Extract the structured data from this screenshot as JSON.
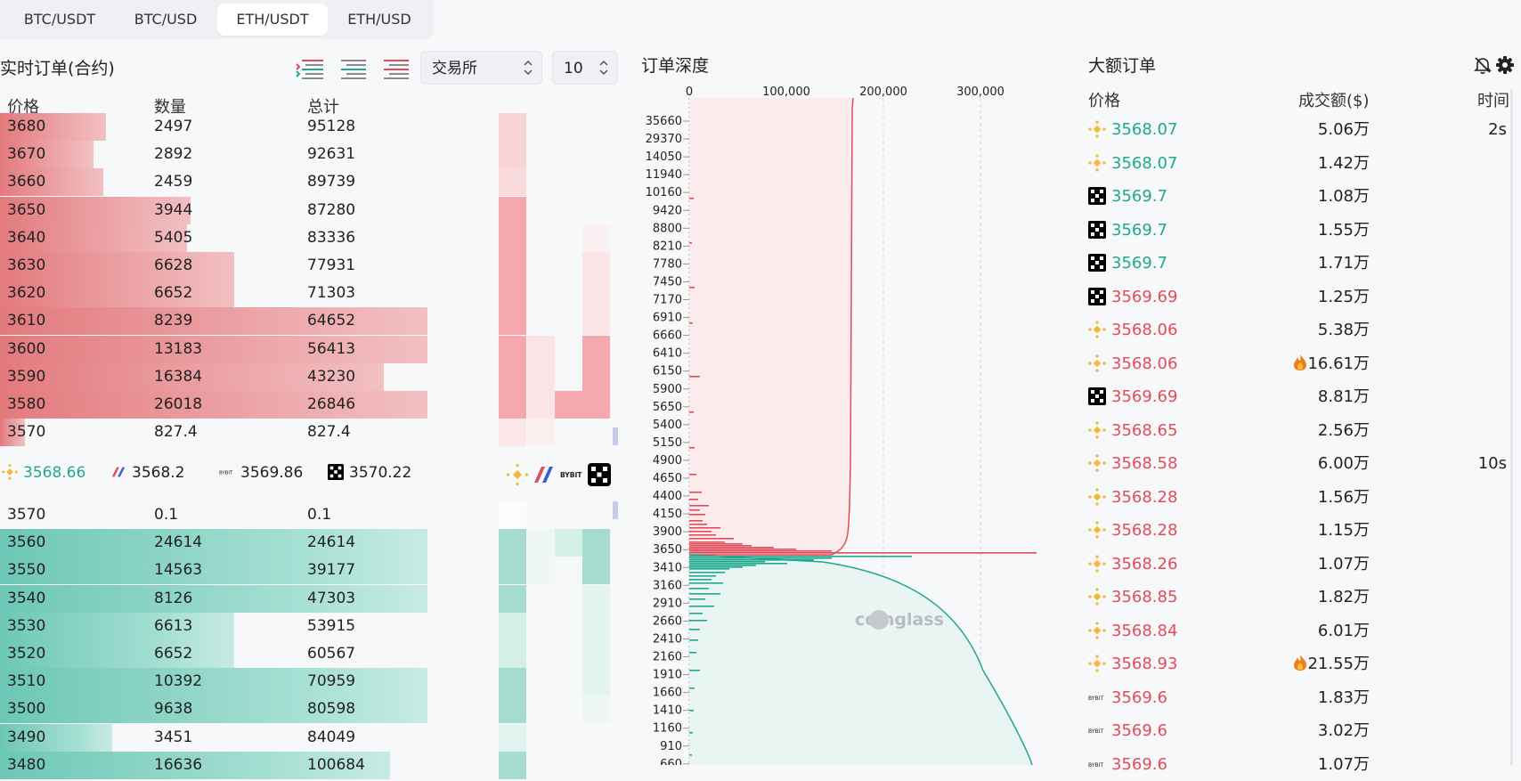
{
  "tabs": [
    {
      "label": "BTC/USDT",
      "active": false
    },
    {
      "label": "BTC/USD",
      "active": false
    },
    {
      "label": "ETH/USDT",
      "active": true
    },
    {
      "label": "ETH/USD",
      "active": false
    }
  ],
  "orderbook": {
    "title": "实时订单(合约)",
    "exchange_select": "交易所",
    "depth_select": "10",
    "headers": {
      "price": "价格",
      "qty": "数量",
      "total": "总计"
    },
    "asks": [
      {
        "price": "3680",
        "qty": "2497",
        "total": "95128",
        "fill": 0.17
      },
      {
        "price": "3670",
        "qty": "2892",
        "total": "92631",
        "fill": 0.15
      },
      {
        "price": "3660",
        "qty": "2459",
        "total": "89739",
        "fill": 0.165
      },
      {
        "price": "3650",
        "qty": "3944",
        "total": "87280",
        "fill": 0.305
      },
      {
        "price": "3640",
        "qty": "5405",
        "total": "83336",
        "fill": 0.3
      },
      {
        "price": "3630",
        "qty": "6628",
        "total": "77931",
        "fill": 0.375
      },
      {
        "price": "3620",
        "qty": "6652",
        "total": "71303",
        "fill": 0.375
      },
      {
        "price": "3610",
        "qty": "8239",
        "total": "64652",
        "fill": 0.685
      },
      {
        "price": "3600",
        "qty": "13183",
        "total": "56413",
        "fill": 0.685
      },
      {
        "price": "3590",
        "qty": "16384",
        "total": "43230",
        "fill": 0.615
      },
      {
        "price": "3580",
        "qty": "26018",
        "total": "26846",
        "fill": 0.685
      },
      {
        "price": "3570",
        "qty": "827.4",
        "total": "827.4",
        "fill": 0.04
      }
    ],
    "exchanges": [
      {
        "name": "binance",
        "price": "3568.66"
      },
      {
        "name": "bitmex",
        "price": "3568.2"
      },
      {
        "name": "bybit",
        "price": "3569.86"
      },
      {
        "name": "okx",
        "price": "3570.22"
      }
    ],
    "bids": [
      {
        "price": "3570",
        "qty": "0.1",
        "total": "0.1",
        "fill": 0.0
      },
      {
        "price": "3560",
        "qty": "24614",
        "total": "24614",
        "fill": 0.685
      },
      {
        "price": "3550",
        "qty": "14563",
        "total": "39177",
        "fill": 0.685
      },
      {
        "price": "3540",
        "qty": "8126",
        "total": "47303",
        "fill": 0.685
      },
      {
        "price": "3530",
        "qty": "6613",
        "total": "53915",
        "fill": 0.375
      },
      {
        "price": "3520",
        "qty": "6652",
        "total": "60567",
        "fill": 0.375
      },
      {
        "price": "3510",
        "qty": "10392",
        "total": "70959",
        "fill": 0.685
      },
      {
        "price": "3500",
        "qty": "9638",
        "total": "80598",
        "fill": 0.685
      },
      {
        "price": "3490",
        "qty": "3451",
        "total": "84049",
        "fill": 0.18
      },
      {
        "price": "3480",
        "qty": "16636",
        "total": "100684",
        "fill": 0.625
      }
    ]
  },
  "depth_chart": {
    "title": "订单深度",
    "watermark": "coinglass",
    "x_ticks": [
      "0",
      "100,000",
      "200,000",
      "300,000"
    ],
    "y_ticks": [
      "35660",
      "29370",
      "14050",
      "11940",
      "10160",
      "9420",
      "8800",
      "8210",
      "7780",
      "7450",
      "7170",
      "6910",
      "6660",
      "6410",
      "6150",
      "5900",
      "5650",
      "5400",
      "5150",
      "4900",
      "4650",
      "4400",
      "4150",
      "3900",
      "3650",
      "3410",
      "3160",
      "2910",
      "2660",
      "2410",
      "2160",
      "1910",
      "1660",
      "1410",
      "1160",
      "910",
      "660"
    ]
  },
  "large_orders": {
    "title": "大额订单",
    "headers": {
      "price": "价格",
      "amount": "成交额($)",
      "time": "时间"
    },
    "rows": [
      {
        "ex": "binance",
        "price": "3568.07",
        "side": "buy",
        "amount": "5.06万",
        "time": "2s",
        "hot": false
      },
      {
        "ex": "binance",
        "price": "3568.07",
        "side": "buy",
        "amount": "1.42万",
        "time": "",
        "hot": false
      },
      {
        "ex": "okx",
        "price": "3569.7",
        "side": "buy",
        "amount": "1.08万",
        "time": "",
        "hot": false
      },
      {
        "ex": "okx",
        "price": "3569.7",
        "side": "buy",
        "amount": "1.55万",
        "time": "",
        "hot": false
      },
      {
        "ex": "okx",
        "price": "3569.7",
        "side": "buy",
        "amount": "1.71万",
        "time": "",
        "hot": false
      },
      {
        "ex": "okx",
        "price": "3569.69",
        "side": "sell",
        "amount": "1.25万",
        "time": "",
        "hot": false
      },
      {
        "ex": "binance",
        "price": "3568.06",
        "side": "sell",
        "amount": "5.38万",
        "time": "",
        "hot": false
      },
      {
        "ex": "binance",
        "price": "3568.06",
        "side": "sell",
        "amount": "16.61万",
        "time": "",
        "hot": true
      },
      {
        "ex": "okx",
        "price": "3569.69",
        "side": "sell",
        "amount": "8.81万",
        "time": "",
        "hot": false
      },
      {
        "ex": "binance",
        "price": "3568.65",
        "side": "sell",
        "amount": "2.56万",
        "time": "",
        "hot": false
      },
      {
        "ex": "binance",
        "price": "3568.58",
        "side": "sell",
        "amount": "6.00万",
        "time": "10s",
        "hot": false
      },
      {
        "ex": "binance",
        "price": "3568.28",
        "side": "sell",
        "amount": "1.56万",
        "time": "",
        "hot": false
      },
      {
        "ex": "binance",
        "price": "3568.28",
        "side": "sell",
        "amount": "1.15万",
        "time": "",
        "hot": false
      },
      {
        "ex": "binance",
        "price": "3568.26",
        "side": "sell",
        "amount": "1.07万",
        "time": "",
        "hot": false
      },
      {
        "ex": "binance",
        "price": "3568.85",
        "side": "sell",
        "amount": "1.82万",
        "time": "",
        "hot": false
      },
      {
        "ex": "binance",
        "price": "3568.84",
        "side": "sell",
        "amount": "6.01万",
        "time": "",
        "hot": false
      },
      {
        "ex": "binance",
        "price": "3568.93",
        "side": "sell",
        "amount": "21.55万",
        "time": "",
        "hot": true
      },
      {
        "ex": "bybit",
        "price": "3569.6",
        "side": "sell",
        "amount": "1.83万",
        "time": "",
        "hot": false
      },
      {
        "ex": "bybit",
        "price": "3569.6",
        "side": "sell",
        "amount": "3.02万",
        "time": "",
        "hot": false
      },
      {
        "ex": "bybit",
        "price": "3569.6",
        "side": "sell",
        "amount": "1.07万",
        "time": "",
        "hot": false
      }
    ]
  },
  "colors": {
    "ask": "#e34b5a",
    "bid": "#20a88f",
    "binance": "#f3ba2f"
  }
}
